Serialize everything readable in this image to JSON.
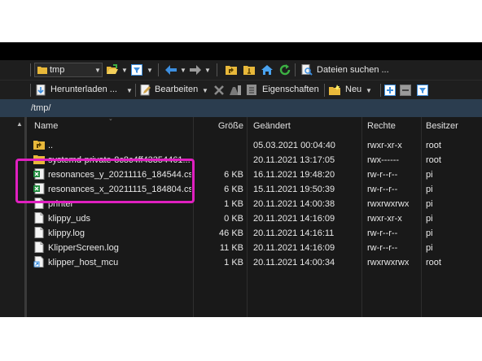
{
  "toolbar1": {
    "folder_name": "tmp",
    "search_label": "Dateien suchen ..."
  },
  "toolbar2": {
    "download_label": "Herunterladen ...",
    "edit_label": "Bearbeiten",
    "properties_label": "Eigenschaften",
    "new_label": "Neu"
  },
  "path": "/tmp/",
  "columns": {
    "name": "Name",
    "size": "Größe",
    "modified": "Geändert",
    "rights": "Rechte",
    "owner": "Besitzer"
  },
  "files": [
    {
      "name": "..",
      "size": "",
      "modified": "05.03.2021 00:04:40",
      "rights": "rwxr-xr-x",
      "owner": "root",
      "icon": "parent-folder-icon"
    },
    {
      "name": "systemd-private-8c8c4ff43354461...",
      "size": "",
      "modified": "20.11.2021 13:17:05",
      "rights": "rwx------",
      "owner": "root",
      "icon": "folder-icon"
    },
    {
      "name": "resonances_y_20211116_184544.csv",
      "size": "6 KB",
      "modified": "16.11.2021 19:48:20",
      "rights": "rw-r--r--",
      "owner": "pi",
      "icon": "spreadsheet-icon"
    },
    {
      "name": "resonances_x_20211115_184804.csv",
      "size": "6 KB",
      "modified": "15.11.2021 19:50:39",
      "rights": "rw-r--r--",
      "owner": "pi",
      "icon": "spreadsheet-icon"
    },
    {
      "name": "printer",
      "size": "1 KB",
      "modified": "20.11.2021 14:00:38",
      "rights": "rwxrwxrwx",
      "owner": "pi",
      "icon": "file-icon"
    },
    {
      "name": "klippy_uds",
      "size": "0 KB",
      "modified": "20.11.2021 14:16:09",
      "rights": "rwxr-xr-x",
      "owner": "pi",
      "icon": "file-icon"
    },
    {
      "name": "klippy.log",
      "size": "46 KB",
      "modified": "20.11.2021 14:16:11",
      "rights": "rw-r--r--",
      "owner": "pi",
      "icon": "file-icon"
    },
    {
      "name": "KlipperScreen.log",
      "size": "11 KB",
      "modified": "20.11.2021 14:16:09",
      "rights": "rw-r--r--",
      "owner": "pi",
      "icon": "file-icon"
    },
    {
      "name": "klipper_host_mcu",
      "size": "1 KB",
      "modified": "20.11.2021 14:00:34",
      "rights": "rwxrwxrwx",
      "owner": "root",
      "icon": "shortcut-icon"
    }
  ],
  "colors": {
    "background": "#1c1c1c",
    "path_bar": "#2b3d4f",
    "highlight": "#e020c0",
    "folder": "#e8b83a",
    "accent_blue": "#3d8fe0",
    "accent_green": "#3cb043"
  }
}
